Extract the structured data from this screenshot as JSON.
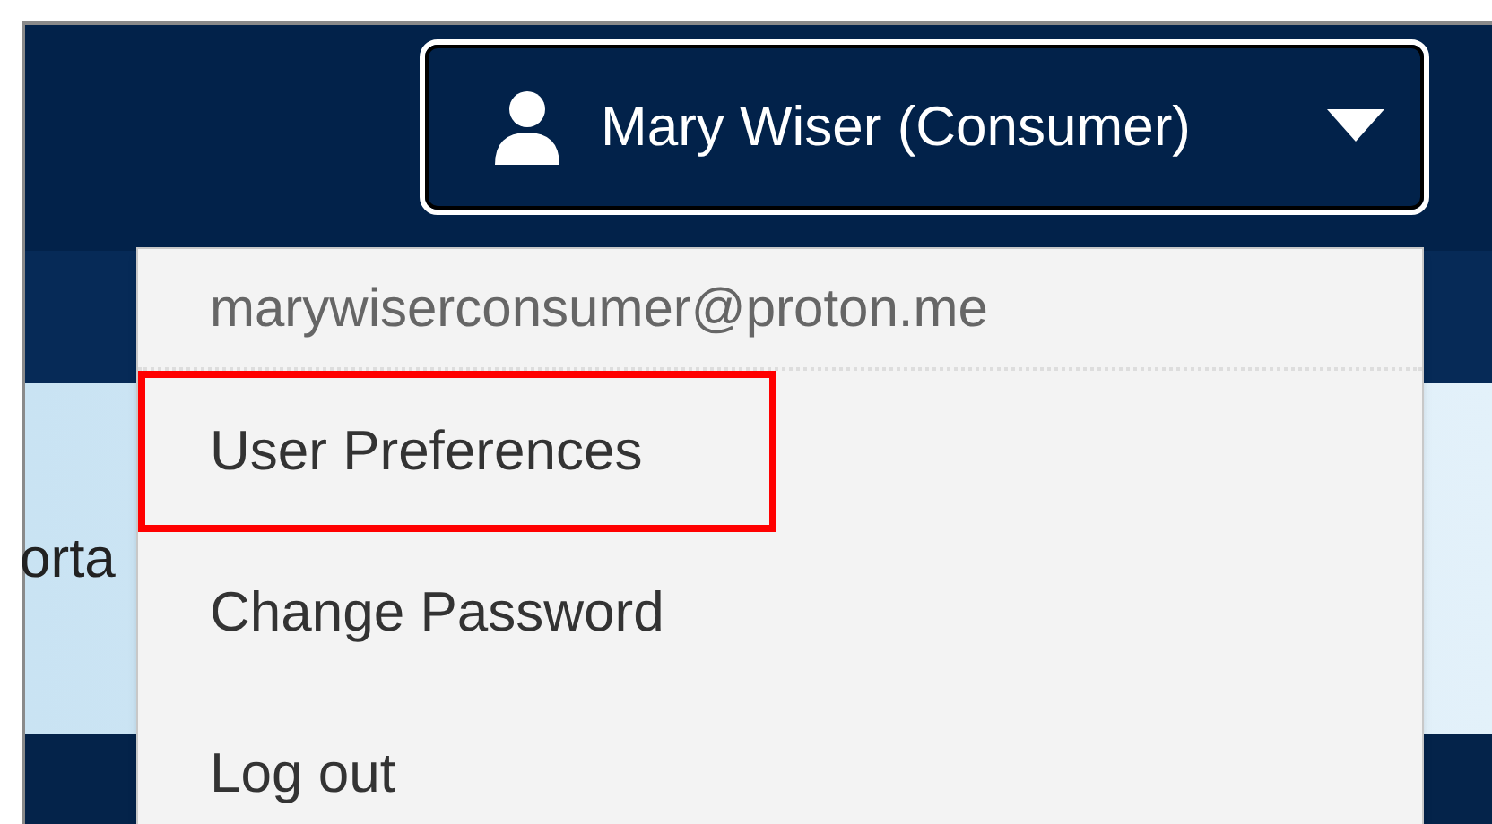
{
  "user_button": {
    "label": "Mary Wiser (Consumer)"
  },
  "background_text": "orta",
  "menu": {
    "email": "marywiserconsumer@proton.me",
    "items": [
      {
        "label": "User Preferences",
        "highlighted": true
      },
      {
        "label": "Change Password",
        "highlighted": false
      },
      {
        "label": "Log out",
        "highlighted": false
      }
    ]
  }
}
